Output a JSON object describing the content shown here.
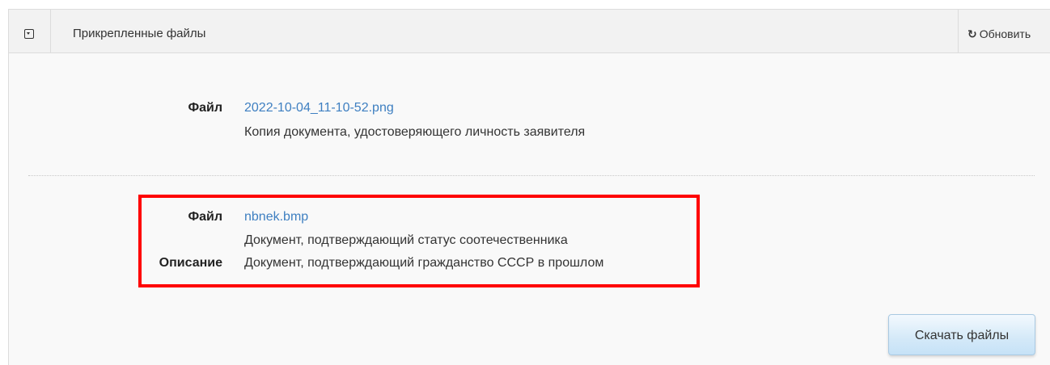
{
  "panel": {
    "title": "Прикрепленные файлы",
    "toggle_icon": "collapse-toggle-icon",
    "refresh": {
      "icon": "refresh-icon",
      "icon_glyph": "↻",
      "label": "Обновить"
    }
  },
  "files": [
    {
      "file_label": "Файл",
      "file_name": "2022-10-04_11-10-52.png",
      "document_type": "Копия документа, удостоверяющего личность заявителя"
    },
    {
      "file_label": "Файл",
      "file_name": "nbnek.bmp",
      "document_type": "Документ, подтверждающий статус соотечественника",
      "description_label": "Описание",
      "description": "Документ, подтверждающий гражданство СССР в прошлом"
    }
  ],
  "actions": {
    "download_label": "Скачать файлы"
  },
  "colors": {
    "link": "#3e7fc1",
    "highlight": "#ff0000",
    "button_bg": "#d4e9f8"
  }
}
